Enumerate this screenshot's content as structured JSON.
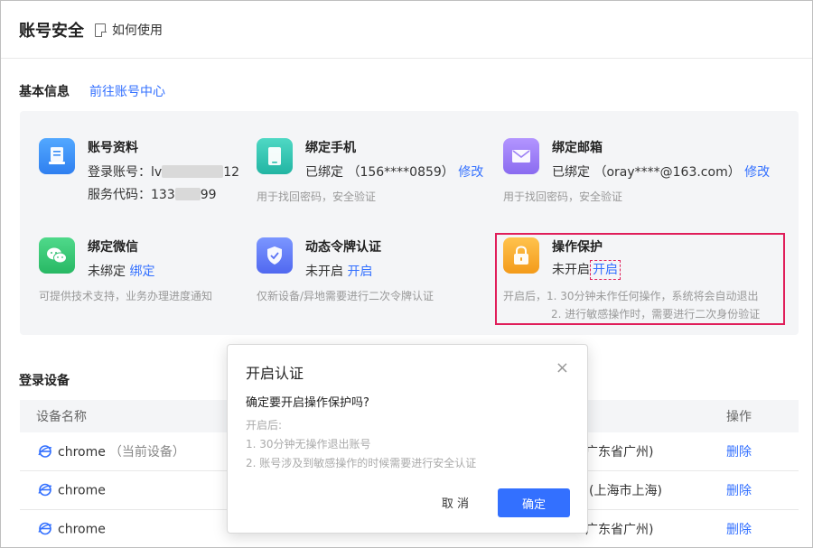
{
  "header": {
    "title": "账号安全",
    "help_label": "如何使用"
  },
  "basic": {
    "title": "基本信息",
    "link": "前往账号中心"
  },
  "cards": {
    "profile": {
      "name": "账号资料",
      "login_label": "登录账号：",
      "login_prefix": "lv",
      "login_suffix": "12",
      "service_label": "服务代码：",
      "service_prefix": "133",
      "service_suffix": "99"
    },
    "phone": {
      "name": "绑定手机",
      "status": "已绑定",
      "value": "（156****0859）",
      "action": "修改",
      "desc": "用于找回密码，安全验证"
    },
    "email": {
      "name": "绑定邮箱",
      "status": "已绑定",
      "value": "（oray****@163.com）",
      "action": "修改",
      "desc": "用于找回密码，安全验证"
    },
    "wechat": {
      "name": "绑定微信",
      "status": "未绑定",
      "action": "绑定",
      "desc": "可提供技术支持，业务办理进度通知"
    },
    "token": {
      "name": "动态令牌认证",
      "status": "未开启",
      "action": "开启",
      "desc": "仅新设备/异地需要进行二次令牌认证"
    },
    "protect": {
      "name": "操作保护",
      "status": "未开启",
      "action": "开启",
      "desc1": "开启后，1. 30分钟未作任何操作，系统将会自动退出",
      "desc2": "2. 进行敏感操作时，需要进行二次身份验证"
    }
  },
  "devices": {
    "title": "登录设备",
    "col_name": "设备名称",
    "col_action": "操作",
    "rows": [
      {
        "name": "chrome",
        "note": "（当前设备）",
        "location": "广东省广州)",
        "action": "删除"
      },
      {
        "name": "chrome",
        "note": "",
        "location": "(上海市上海)",
        "action": "删除"
      },
      {
        "name": "chrome",
        "note": "",
        "location": "广东省广州)",
        "action": "删除"
      }
    ]
  },
  "modal": {
    "title": "开启认证",
    "close": "×",
    "question": "确定要开启操作保护吗?",
    "line1": "开启后:",
    "line2": "1. 30分钟无操作退出账号",
    "line3": "2. 账号涉及到敏感操作的时候需要进行安全认证",
    "cancel": "取 消",
    "ok": "确定"
  },
  "colors": {
    "accent": "#3370ff",
    "highlight": "#e01e5a"
  }
}
